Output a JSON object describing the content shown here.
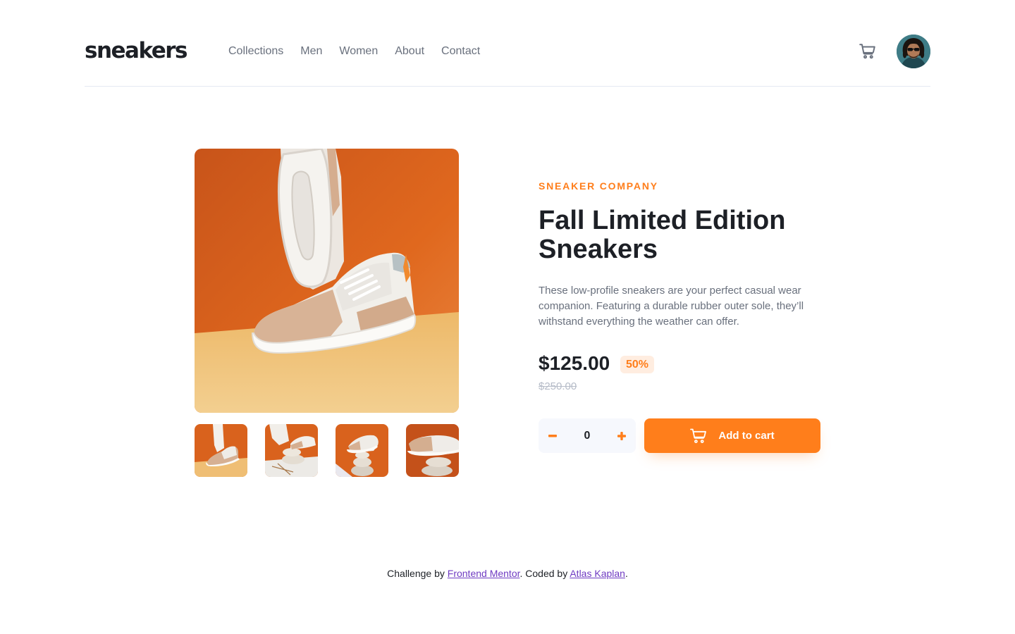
{
  "brand": {
    "logo": "sneakers"
  },
  "nav": [
    "Collections",
    "Men",
    "Women",
    "About",
    "Contact"
  ],
  "colors": {
    "accent": "#ff7e1b",
    "accent_pale": "#ffede0",
    "text_dark": "#1d2026",
    "text_muted": "#69707d",
    "text_faint": "#b6bcc8",
    "link": "#6f3bc2"
  },
  "icons": {
    "cart": "cart-icon",
    "minus": "minus-icon",
    "plus": "plus-icon",
    "avatar": "user-avatar"
  },
  "product": {
    "company": "SNEAKER COMPANY",
    "title": "Fall Limited Edition Sneakers",
    "description": "These low-profile sneakers are your perfect casual wear companion. Featuring a durable rubber outer sole, they’ll withstand everything the weather can offer.",
    "price": "$125.00",
    "discount": "50%",
    "original_price": "$250.00",
    "quantity": "0",
    "add_to_cart": "Add to cart"
  },
  "footer": {
    "prefix": "Challenge by",
    "link1": "Frontend Mentor",
    "middle": ". Coded by",
    "link2": "Atlas Kaplan",
    "suffix": "."
  }
}
